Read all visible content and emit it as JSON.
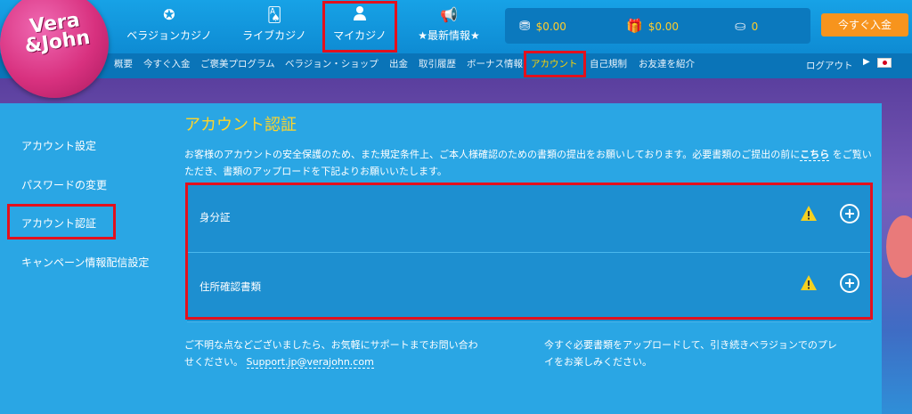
{
  "logo": {
    "line1": "Vera",
    "line2": "&John"
  },
  "nav": [
    {
      "label": "ベラジョンカジノ",
      "icon": "chip-icon"
    },
    {
      "label": "ライブカジノ",
      "icon": "cards-icon"
    },
    {
      "label": "マイカジノ",
      "icon": "user-icon"
    },
    {
      "label": "★最新情報★",
      "icon": "megaphone-icon"
    }
  ],
  "wallet": {
    "cash": "$0.00",
    "bonus": "$0.00",
    "points": "0",
    "deposit_label": "今すぐ入金"
  },
  "subnav": [
    "概要",
    "今すぐ入金",
    "ご褒美プログラム",
    "ベラジョン・ショップ",
    "出金",
    "取引履歴",
    "ボーナス情報",
    "アカウント",
    "自己規制",
    "お友達を紹介"
  ],
  "logout": "ログアウト",
  "sidebar": [
    "アカウント設定",
    "パスワードの変更",
    "アカウント認証",
    "キャンペーン情報配信設定"
  ],
  "main": {
    "title": "アカウント認証",
    "desc_1": "お客様のアカウントの安全保護のため、また規定条件上、ご本人様確認のための書類の提出をお願いしております。必要書類のご提出の前に",
    "desc_link": "こちら",
    "desc_2": "をご覧いただき、書類のアップロードを下記よりお願いいたします。",
    "items": [
      "身分証",
      "住所確認書類"
    ]
  },
  "footer": {
    "left_1": "ご不明な点などございましたら、お気軽にサポートまでお問い合わ",
    "left_2": "せください。",
    "email": "Support.jp@verajohn.com",
    "right_1": "今すぐ必要書類をアップロードして、引き続きベラジョンでのプレ",
    "right_2": "イをお楽しみください。"
  },
  "colors": {
    "accent": "#ffd52a",
    "highlight_box": "#e3101d",
    "deposit": "#f7941d"
  }
}
